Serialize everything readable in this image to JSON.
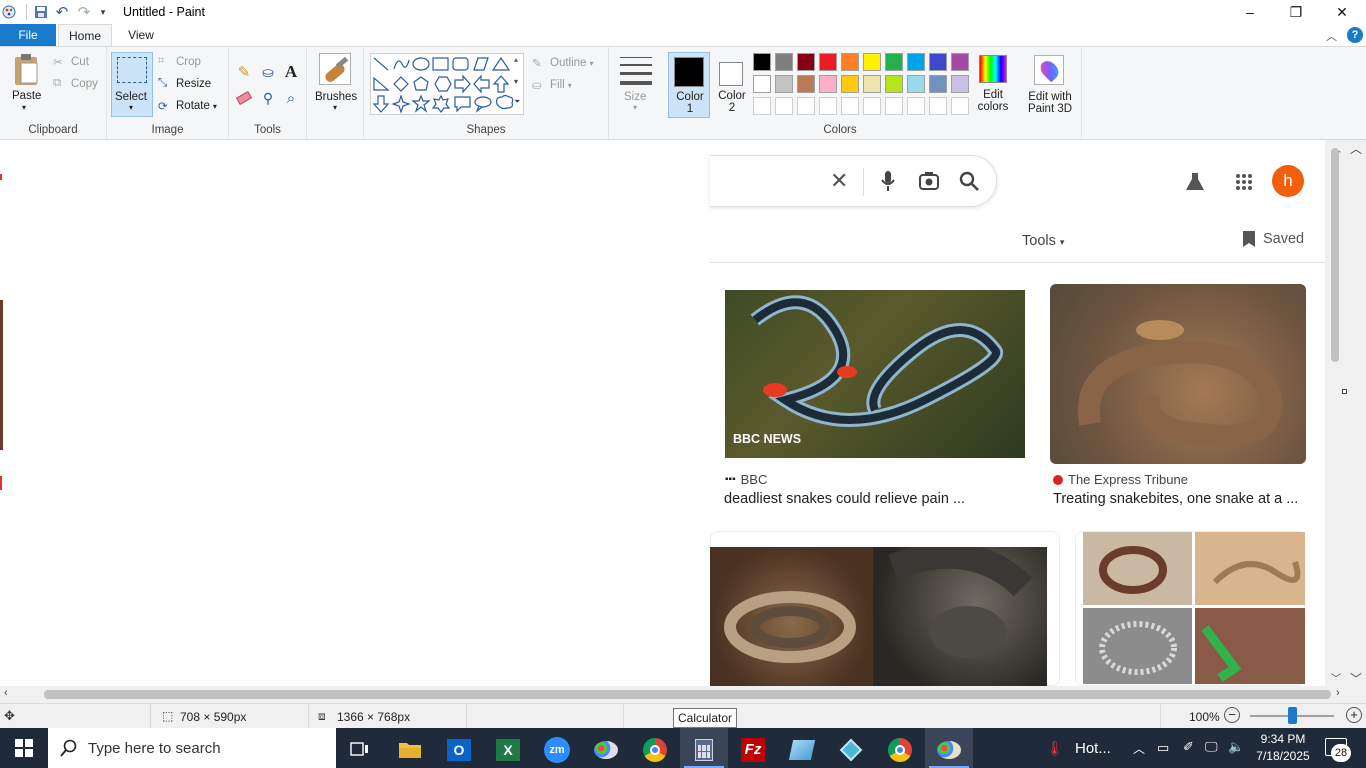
{
  "window": {
    "title": "Untitled - Paint",
    "minimize": "–",
    "maximize": "❐",
    "close": "✕"
  },
  "tabs": {
    "file": "File",
    "home": "Home",
    "view": "View"
  },
  "clipboard": {
    "paste": "Paste",
    "cut": "Cut",
    "copy": "Copy",
    "label": "Clipboard"
  },
  "image": {
    "select": "Select",
    "crop": "Crop",
    "resize": "Resize",
    "rotate": "Rotate",
    "label": "Image"
  },
  "tools": {
    "label": "Tools"
  },
  "brushes": {
    "label": "Brushes"
  },
  "shapes": {
    "outline": "Outline",
    "fill": "Fill",
    "label": "Shapes"
  },
  "size": {
    "label": "Size"
  },
  "colors": {
    "color1": "Color 1",
    "color2": "Color 2",
    "edit_colors": "Edit colors",
    "edit_paint3d": "Edit with Paint 3D",
    "label": "Colors",
    "color1_value": "#000000",
    "color2_value": "#ffffff",
    "palette_row1": [
      "#000000",
      "#7f7f7f",
      "#880015",
      "#ed1c24",
      "#ff7f27",
      "#fff200",
      "#22b14c",
      "#00a2e8",
      "#3f48cc",
      "#a349a4"
    ],
    "palette_row2": [
      "#ffffff",
      "#c3c3c3",
      "#b97a57",
      "#ffaec9",
      "#ffc90e",
      "#efe4b0",
      "#b5e61d",
      "#99d9ea",
      "#7092be",
      "#c8bfe7"
    ]
  },
  "google": {
    "tools": "Tools",
    "saved": "Saved",
    "avatar": "h",
    "results": [
      {
        "source": "BBC",
        "title": "deadliest snakes could relieve pain ...",
        "overlay": "BBC NEWS"
      },
      {
        "source": "The Express Tribune",
        "title": "Treating snakebites, one snake at a ..."
      }
    ]
  },
  "status": {
    "selection": "708 × 590px",
    "canvas": "1366 × 768px",
    "zoom": "100%",
    "tooltip": "Calculator"
  },
  "taskbar": {
    "search_placeholder": "Type here to search",
    "weather": "Hot...",
    "time": "9:34 PM",
    "date": "7/18/2025",
    "notifications": "28"
  }
}
